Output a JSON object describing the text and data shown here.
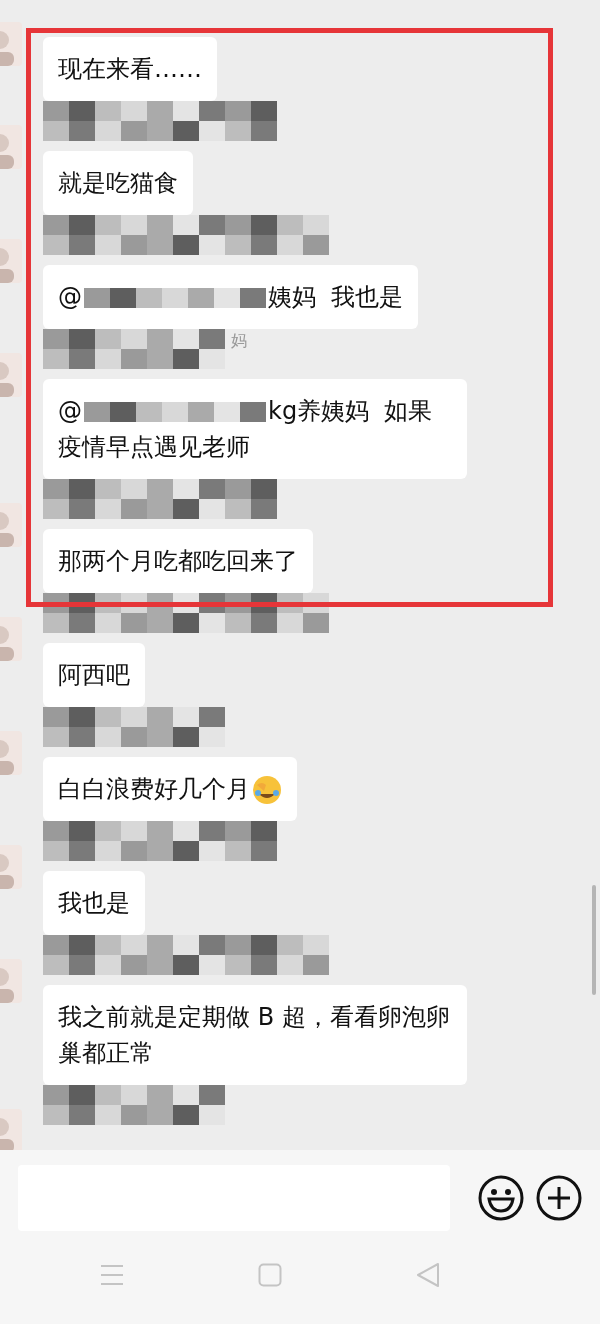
{
  "messages": [
    {
      "sender_redacted": false,
      "highlighted": true,
      "parts": [
        {
          "kind": "text",
          "text": "现在来看……"
        }
      ]
    },
    {
      "sender_redacted": true,
      "highlighted": true,
      "parts": [
        {
          "kind": "text",
          "text": "就是吃猫食"
        }
      ]
    },
    {
      "sender_redacted": true,
      "highlighted": true,
      "parts": [
        {
          "kind": "text",
          "text": "@"
        },
        {
          "kind": "redacted"
        },
        {
          "kind": "text",
          "text": "姨妈  我也是"
        }
      ]
    },
    {
      "sender_redacted": true,
      "sender_fragment": "妈",
      "highlighted": true,
      "parts": [
        {
          "kind": "text",
          "text": "@"
        },
        {
          "kind": "redacted"
        },
        {
          "kind": "text",
          "text": "kg养姨妈  如果"
        },
        {
          "kind": "text",
          "text": "疫情早点遇见老师"
        }
      ]
    },
    {
      "sender_redacted": true,
      "highlighted": true,
      "parts": [
        {
          "kind": "text",
          "text": "那两个月吃都吃回来了"
        }
      ]
    },
    {
      "sender_redacted": true,
      "highlighted": false,
      "parts": [
        {
          "kind": "text",
          "text": "阿西吧"
        }
      ]
    },
    {
      "sender_redacted": true,
      "highlighted": false,
      "parts": [
        {
          "kind": "text",
          "text": "白白浪费好几个月"
        },
        {
          "kind": "emoji"
        }
      ]
    },
    {
      "sender_redacted": true,
      "highlighted": false,
      "parts": [
        {
          "kind": "text",
          "text": "我也是"
        }
      ]
    },
    {
      "sender_redacted": true,
      "highlighted": false,
      "parts": [
        {
          "kind": "text",
          "text": "我之前就是定期做 B 超，看看卵泡卵巢都正常"
        }
      ]
    },
    {
      "sender_redacted": true,
      "highlighted": false
    }
  ]
}
